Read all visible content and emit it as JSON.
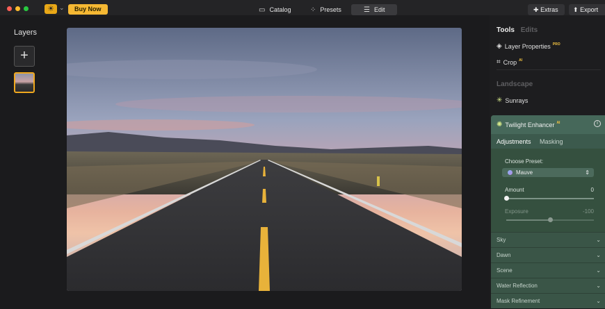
{
  "topbar": {
    "buy_now": "Buy Now",
    "catalog": "Catalog",
    "presets": "Presets",
    "edit": "Edit",
    "extras": "Extras",
    "export": "Export"
  },
  "layers": {
    "title": "Layers",
    "add_symbol": "+"
  },
  "panel": {
    "tab_tools": "Tools",
    "tab_edits": "Edits",
    "layer_properties": "Layer Properties",
    "layer_properties_badge": "PRO",
    "crop": "Crop",
    "crop_badge": "AI",
    "section_landscape": "Landscape",
    "sunrays": "Sunrays",
    "enhancer": {
      "title": "Twilight Enhancer",
      "badge": "AI",
      "info": "i",
      "subtab_adjustments": "Adjustments",
      "subtab_masking": "Masking",
      "choose_preset_label": "Choose Preset:",
      "preset_value": "Mauve",
      "amount_label": "Amount",
      "amount_value": "0",
      "amount_fraction": 0.0,
      "exposure_label": "Exposure",
      "exposure_value": "-100",
      "exposure_fraction": 0.5
    },
    "collapsed_sections": [
      "Sky",
      "Dawn",
      "Scene",
      "Water Reflection",
      "Mask Refinement"
    ]
  },
  "colors": {
    "accent": "#f5b833",
    "enhancer_panel": "#3c5a4d"
  },
  "icons": {
    "catalog": "catalog-icon",
    "presets": "presets-icon",
    "edit": "edit-sliders-icon",
    "extras": "puzzle-icon",
    "export": "export-icon"
  }
}
